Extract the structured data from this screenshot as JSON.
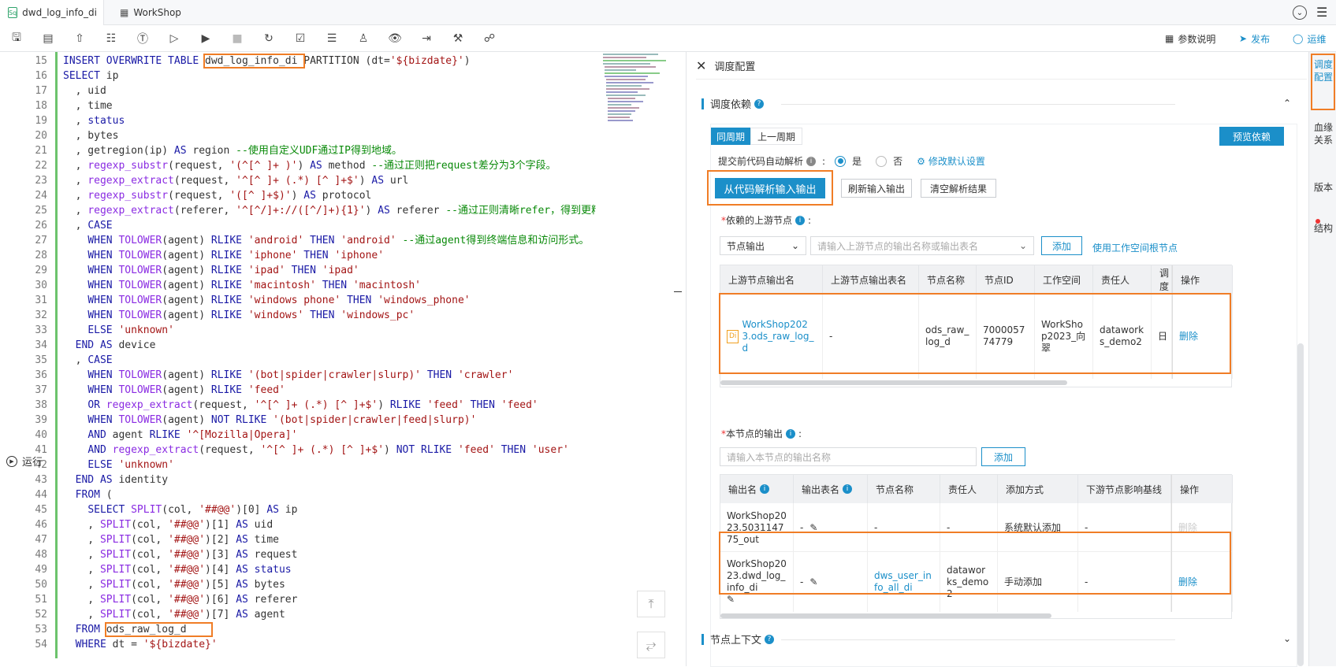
{
  "tabs": [
    {
      "label": "dwd_log_info_di",
      "icon": "sql-file-icon"
    },
    {
      "label": "WorkShop",
      "icon": "workshop-icon"
    }
  ],
  "toolbar": {
    "params_label": "参数说明",
    "publish_label": "发布",
    "ops_label": "运维"
  },
  "editor": {
    "run_label": "运行",
    "lines": [
      {
        "n": "15",
        "html": "<span class='kw'>INSERT OVERWRITE TABLE</span> <span class='hl'>dwd_log_info_di </span>PARTITION (dt=<span class='st'>'${bizdate}'</span>)"
      },
      {
        "n": "16",
        "html": "<span class='kw'>SELECT</span> ip"
      },
      {
        "n": "17",
        "html": "  , uid"
      },
      {
        "n": "18",
        "html": "  , time"
      },
      {
        "n": "19",
        "html": "  , <span class='kw'>status</span>"
      },
      {
        "n": "20",
        "html": "  , bytes"
      },
      {
        "n": "21",
        "html": "  , getregion(ip) <span class='kw'>AS</span> region <span class='cm'>--使用自定义UDF通过IP得到地域。</span>"
      },
      {
        "n": "22",
        "html": "  , <span class='fn'>regexp_substr</span>(request, <span class='st'>'(^[^ ]+ )'</span>) <span class='kw'>AS</span> method <span class='cm'>--通过正则把request差分为3个字段。</span>"
      },
      {
        "n": "23",
        "html": "  , <span class='fn'>regexp_extract</span>(request, <span class='st'>'^[^ ]+ (.*) [^ ]+$'</span>) <span class='kw'>AS</span> url"
      },
      {
        "n": "24",
        "html": "  , <span class='fn'>regexp_substr</span>(request, <span class='st'>'([^ ]+$)'</span>) <span class='kw'>AS</span> protocol"
      },
      {
        "n": "25",
        "html": "  , <span class='fn'>regexp_extract</span>(referer, <span class='st'>'^[^/]+://([^/]+){1}'</span>) <span class='kw'>AS</span> referer <span class='cm'>--通过正则清晰refer，得到更精</span>"
      },
      {
        "n": "26",
        "html": "  , <span class='kw'>CASE</span>"
      },
      {
        "n": "27",
        "html": "    <span class='kw'>WHEN</span> <span class='fn'>TOLOWER</span>(agent) <span class='kw'>RLIKE</span> <span class='st'>'android'</span> <span class='kw'>THEN</span> <span class='st'>'android'</span> <span class='cm'>--通过agent得到终端信息和访问形式。</span>"
      },
      {
        "n": "28",
        "html": "    <span class='kw'>WHEN</span> <span class='fn'>TOLOWER</span>(agent) <span class='kw'>RLIKE</span> <span class='st'>'iphone'</span> <span class='kw'>THEN</span> <span class='st'>'iphone'</span>"
      },
      {
        "n": "29",
        "html": "    <span class='kw'>WHEN</span> <span class='fn'>TOLOWER</span>(agent) <span class='kw'>RLIKE</span> <span class='st'>'ipad'</span> <span class='kw'>THEN</span> <span class='st'>'ipad'</span>"
      },
      {
        "n": "30",
        "html": "    <span class='kw'>WHEN</span> <span class='fn'>TOLOWER</span>(agent) <span class='kw'>RLIKE</span> <span class='st'>'macintosh'</span> <span class='kw'>THEN</span> <span class='st'>'macintosh'</span>"
      },
      {
        "n": "31",
        "html": "    <span class='kw'>WHEN</span> <span class='fn'>TOLOWER</span>(agent) <span class='kw'>RLIKE</span> <span class='st'>'windows phone'</span> <span class='kw'>THEN</span> <span class='st'>'windows_phone'</span>"
      },
      {
        "n": "32",
        "html": "    <span class='kw'>WHEN</span> <span class='fn'>TOLOWER</span>(agent) <span class='kw'>RLIKE</span> <span class='st'>'windows'</span> <span class='kw'>THEN</span> <span class='st'>'windows_pc'</span>"
      },
      {
        "n": "33",
        "html": "    <span class='kw'>ELSE</span> <span class='st'>'unknown'</span>"
      },
      {
        "n": "34",
        "html": "  <span class='kw'>END AS</span> device"
      },
      {
        "n": "35",
        "html": "  , <span class='kw'>CASE</span>"
      },
      {
        "n": "36",
        "html": "    <span class='kw'>WHEN</span> <span class='fn'>TOLOWER</span>(agent) <span class='kw'>RLIKE</span> <span class='st'>'(bot|spider|crawler|slurp)'</span> <span class='kw'>THEN</span> <span class='st'>'crawler'</span>"
      },
      {
        "n": "37",
        "html": "    <span class='kw'>WHEN</span> <span class='fn'>TOLOWER</span>(agent) <span class='kw'>RLIKE</span> <span class='st'>'feed'</span>"
      },
      {
        "n": "38",
        "html": "    <span class='kw'>OR</span> <span class='fn'>regexp_extract</span>(request, <span class='st'>'^[^ ]+ (.*) [^ ]+$'</span>) <span class='kw'>RLIKE</span> <span class='st'>'feed'</span> <span class='kw'>THEN</span> <span class='st'>'feed'</span>"
      },
      {
        "n": "39",
        "html": "    <span class='kw'>WHEN</span> <span class='fn'>TOLOWER</span>(agent) <span class='kw'>NOT RLIKE</span> <span class='st'>'(bot|spider|crawler|feed|slurp)'</span>"
      },
      {
        "n": "40",
        "html": "    <span class='kw'>AND</span> agent <span class='kw'>RLIKE</span> <span class='st'>'^[Mozilla|Opera]'</span>"
      },
      {
        "n": "41",
        "html": "    <span class='kw'>AND</span> <span class='fn'>regexp_extract</span>(request, <span class='st'>'^[^ ]+ (.*) [^ ]+$'</span>) <span class='kw'>NOT RLIKE</span> <span class='st'>'feed'</span> <span class='kw'>THEN</span> <span class='st'>'user'</span>"
      },
      {
        "n": "42",
        "html": "    <span class='kw'>ELSE</span> <span class='st'>'unknown'</span>"
      },
      {
        "n": "43",
        "html": "  <span class='kw'>END AS</span> identity"
      },
      {
        "n": "44",
        "html": "  <span class='kw'>FROM</span> ("
      },
      {
        "n": "45",
        "html": "    <span class='kw'>SELECT</span> <span class='fn'>SPLIT</span>(col, <span class='st'>'##@@'</span>)[0] <span class='kw'>AS</span> ip"
      },
      {
        "n": "46",
        "html": "    , <span class='fn'>SPLIT</span>(col, <span class='st'>'##@@'</span>)[1] <span class='kw'>AS</span> uid"
      },
      {
        "n": "47",
        "html": "    , <span class='fn'>SPLIT</span>(col, <span class='st'>'##@@'</span>)[2] <span class='kw'>AS</span> time"
      },
      {
        "n": "48",
        "html": "    , <span class='fn'>SPLIT</span>(col, <span class='st'>'##@@'</span>)[3] <span class='kw'>AS</span> request"
      },
      {
        "n": "49",
        "html": "    , <span class='fn'>SPLIT</span>(col, <span class='st'>'##@@'</span>)[4] <span class='kw'>AS</span> <span class='kw'>status</span>"
      },
      {
        "n": "50",
        "html": "    , <span class='fn'>SPLIT</span>(col, <span class='st'>'##@@'</span>)[5] <span class='kw'>AS</span> bytes"
      },
      {
        "n": "51",
        "html": "    , <span class='fn'>SPLIT</span>(col, <span class='st'>'##@@'</span>)[6] <span class='kw'>AS</span> referer"
      },
      {
        "n": "52",
        "html": "    , <span class='fn'>SPLIT</span>(col, <span class='st'>'##@@'</span>)[7] <span class='kw'>AS</span> agent"
      },
      {
        "n": "53",
        "html": "  <span class='kw'>FROM</span> <span class='hl'>ods_raw_log_d    </span>"
      },
      {
        "n": "54",
        "html": "  <span class='kw'>WHERE</span> dt = <span class='st'>'${bizdate}'</span>"
      }
    ]
  },
  "panel": {
    "title": "调度配置",
    "dep_section": "调度依赖",
    "tab_same": "同周期",
    "tab_prev": "上一周期",
    "preview_btn": "预览依赖",
    "auto_parse_label": "提交前代码自动解析",
    "radio_yes": "是",
    "radio_no": "否",
    "modify_default": "修改默认设置",
    "parse_btn": "从代码解析输入输出",
    "refresh_btn": "刷新输入输出",
    "clear_btn": "清空解析结果",
    "upstream_label": "依赖的上游节点",
    "upstream_select": "节点输出",
    "upstream_placeholder": "请输入上游节点的输出名称或输出表名",
    "add_btn": "添加",
    "use_root": "使用工作空间根节点",
    "up_headers": [
      "上游节点输出名",
      "上游节点输出表名",
      "节点名称",
      "节点ID",
      "工作空间",
      "责任人",
      "调度",
      "操作"
    ],
    "up_row": {
      "badge": "Di",
      "output_name": "WorkShop2023.ods_raw_log_d",
      "table_name": "-",
      "node_name": "ods_raw_log_d",
      "node_id": "700005774779",
      "workspace": "WorkShop2023_向翠",
      "owner": "dataworks_demo2",
      "sched": "日",
      "op": "删除"
    },
    "output_label": "本节点的输出",
    "output_placeholder": "请输入本节点的输出名称",
    "out_headers": [
      "输出名",
      "输出表名",
      "节点名称",
      "责任人",
      "添加方式",
      "下游节点影响基线",
      "操作"
    ],
    "out_rows": [
      {
        "name": "WorkShop2023.503114775_out",
        "table": "-",
        "node": "-",
        "owner": "-",
        "way": "系统默认添加",
        "baseline": "-",
        "op": "删除"
      },
      {
        "name": "WorkShop2023.dwd_log_info_di",
        "table": "-",
        "node": "dws_user_info_all_di",
        "owner": "dataworks_demo2",
        "way": "手动添加",
        "baseline": "-",
        "op": "删除"
      }
    ],
    "context_section": "节点上下文"
  },
  "sidebar": {
    "items": [
      "调度配置",
      "血缘关系",
      "版本",
      "结构"
    ]
  },
  "colors": {
    "accent": "#1b8fc9",
    "highlight": "#f07d26"
  }
}
